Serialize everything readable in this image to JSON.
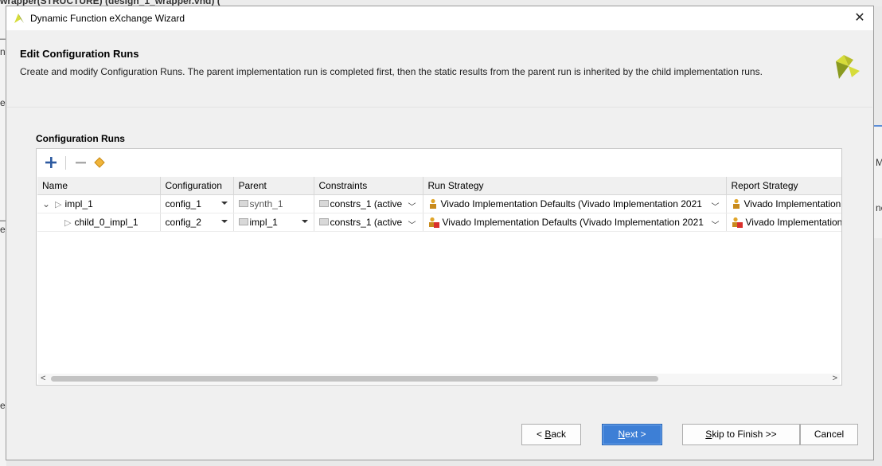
{
  "background": {
    "top_left_text": "wrapper(STRUCTURE) (design_1_wrapper.vhd) (",
    "left_fragments": [
      "_",
      "n",
      "es",
      "_",
      "es",
      "ec"
    ],
    "right_fragments": [
      "M",
      "ne"
    ]
  },
  "dialog": {
    "title": "Dynamic Function eXchange Wizard",
    "close_glyph": "✕"
  },
  "header": {
    "title": "Edit Configuration Runs",
    "description": "Create and modify Configuration Runs. The parent implementation run is completed first, then the static results from the parent run is inherited by the child implementation runs."
  },
  "section": {
    "label": "Configuration Runs"
  },
  "toolbar": {
    "add_icon": "plus-icon",
    "remove_icon": "minus-icon",
    "diamond_icon": "diamond-icon"
  },
  "table": {
    "columns": [
      "Name",
      "Configuration",
      "Parent",
      "Constraints",
      "Run Strategy",
      "Report Strategy"
    ],
    "rows": [
      {
        "expand_glyph": "⌄",
        "play_glyph": "▷",
        "name": "impl_1",
        "configuration": "config_1",
        "parent": "synth_1",
        "constraints": "constrs_1 (active",
        "run_strategy": "Vivado Implementation Defaults (Vivado Implementation 2021",
        "report_strategy": "Vivado Implementation"
      },
      {
        "expand_glyph": "",
        "play_glyph": "▷",
        "name": "child_0_impl_1",
        "configuration": "config_2",
        "parent": "impl_1",
        "constraints": "constrs_1 (active",
        "run_strategy": "Vivado Implementation Defaults (Vivado Implementation 2021",
        "report_strategy": "Vivado Implementation"
      }
    ]
  },
  "scrollbar": {
    "left_arrow": "<",
    "right_arrow": ">"
  },
  "buttons": {
    "back": {
      "prefix": "< ",
      "mnemonic": "B",
      "rest": "ack"
    },
    "next": {
      "mnemonic": "N",
      "rest": "ext >"
    },
    "skip": {
      "mnemonic": "S",
      "rest": "kip to Finish >>"
    },
    "cancel": "Cancel"
  },
  "colors": {
    "accent": "#3d7fd6",
    "logo_yellow": "#d6dc3a",
    "logo_green": "#8a9a1f"
  }
}
